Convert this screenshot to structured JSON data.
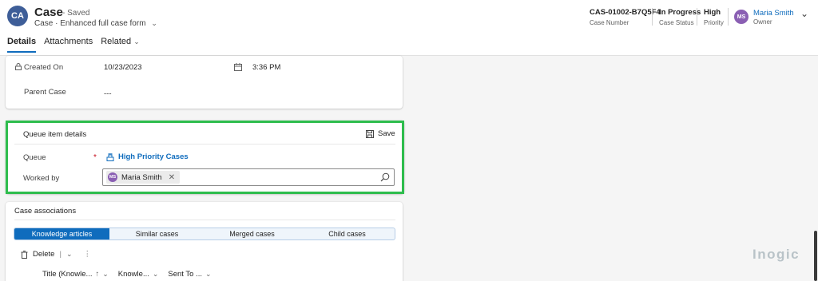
{
  "header": {
    "avatar_initials": "CA",
    "title": "Case",
    "saved_status": "- Saved",
    "entity": "Case",
    "form_selector": "Enhanced full case form",
    "fields": [
      {
        "value": "CAS-01002-B7Q5F4",
        "label": "Case Number"
      },
      {
        "value": "In Progress",
        "label": "Case Status"
      },
      {
        "value": "High",
        "label": "Priority"
      }
    ],
    "owner": {
      "initials": "MS",
      "name": "Maria Smith",
      "label": "Owner"
    }
  },
  "tabs": [
    {
      "label": "Details",
      "active": true
    },
    {
      "label": "Attachments",
      "active": false
    },
    {
      "label": "Related",
      "active": false
    }
  ],
  "details_card": {
    "created_on_label": "Created On",
    "created_on_date": "10/23/2023",
    "created_on_time": "3:36 PM",
    "parent_case_label": "Parent Case",
    "parent_case_value": "---"
  },
  "queue_card": {
    "title": "Queue item details",
    "save_label": "Save",
    "queue_label": "Queue",
    "queue_required_marker": "*",
    "queue_value": "High Priority Cases",
    "worked_by_label": "Worked by",
    "worked_by_initials": "MS",
    "worked_by_value": "Maria Smith",
    "chip_close": "✕"
  },
  "associations": {
    "title": "Case associations",
    "tabs": [
      "Knowledge articles",
      "Similar cases",
      "Merged cases",
      "Child cases"
    ],
    "active_tab": 0,
    "command_delete": "Delete",
    "columns": [
      "Title (Knowle...",
      "Knowle...",
      "Sent To ..."
    ]
  },
  "brand_watermark": "Inogic",
  "colors": {
    "accent": "#0f6cbd",
    "highlight_border": "#2ebd4d",
    "avatar_case": "#3e5e98",
    "avatar_user": "#8a5fb3"
  }
}
